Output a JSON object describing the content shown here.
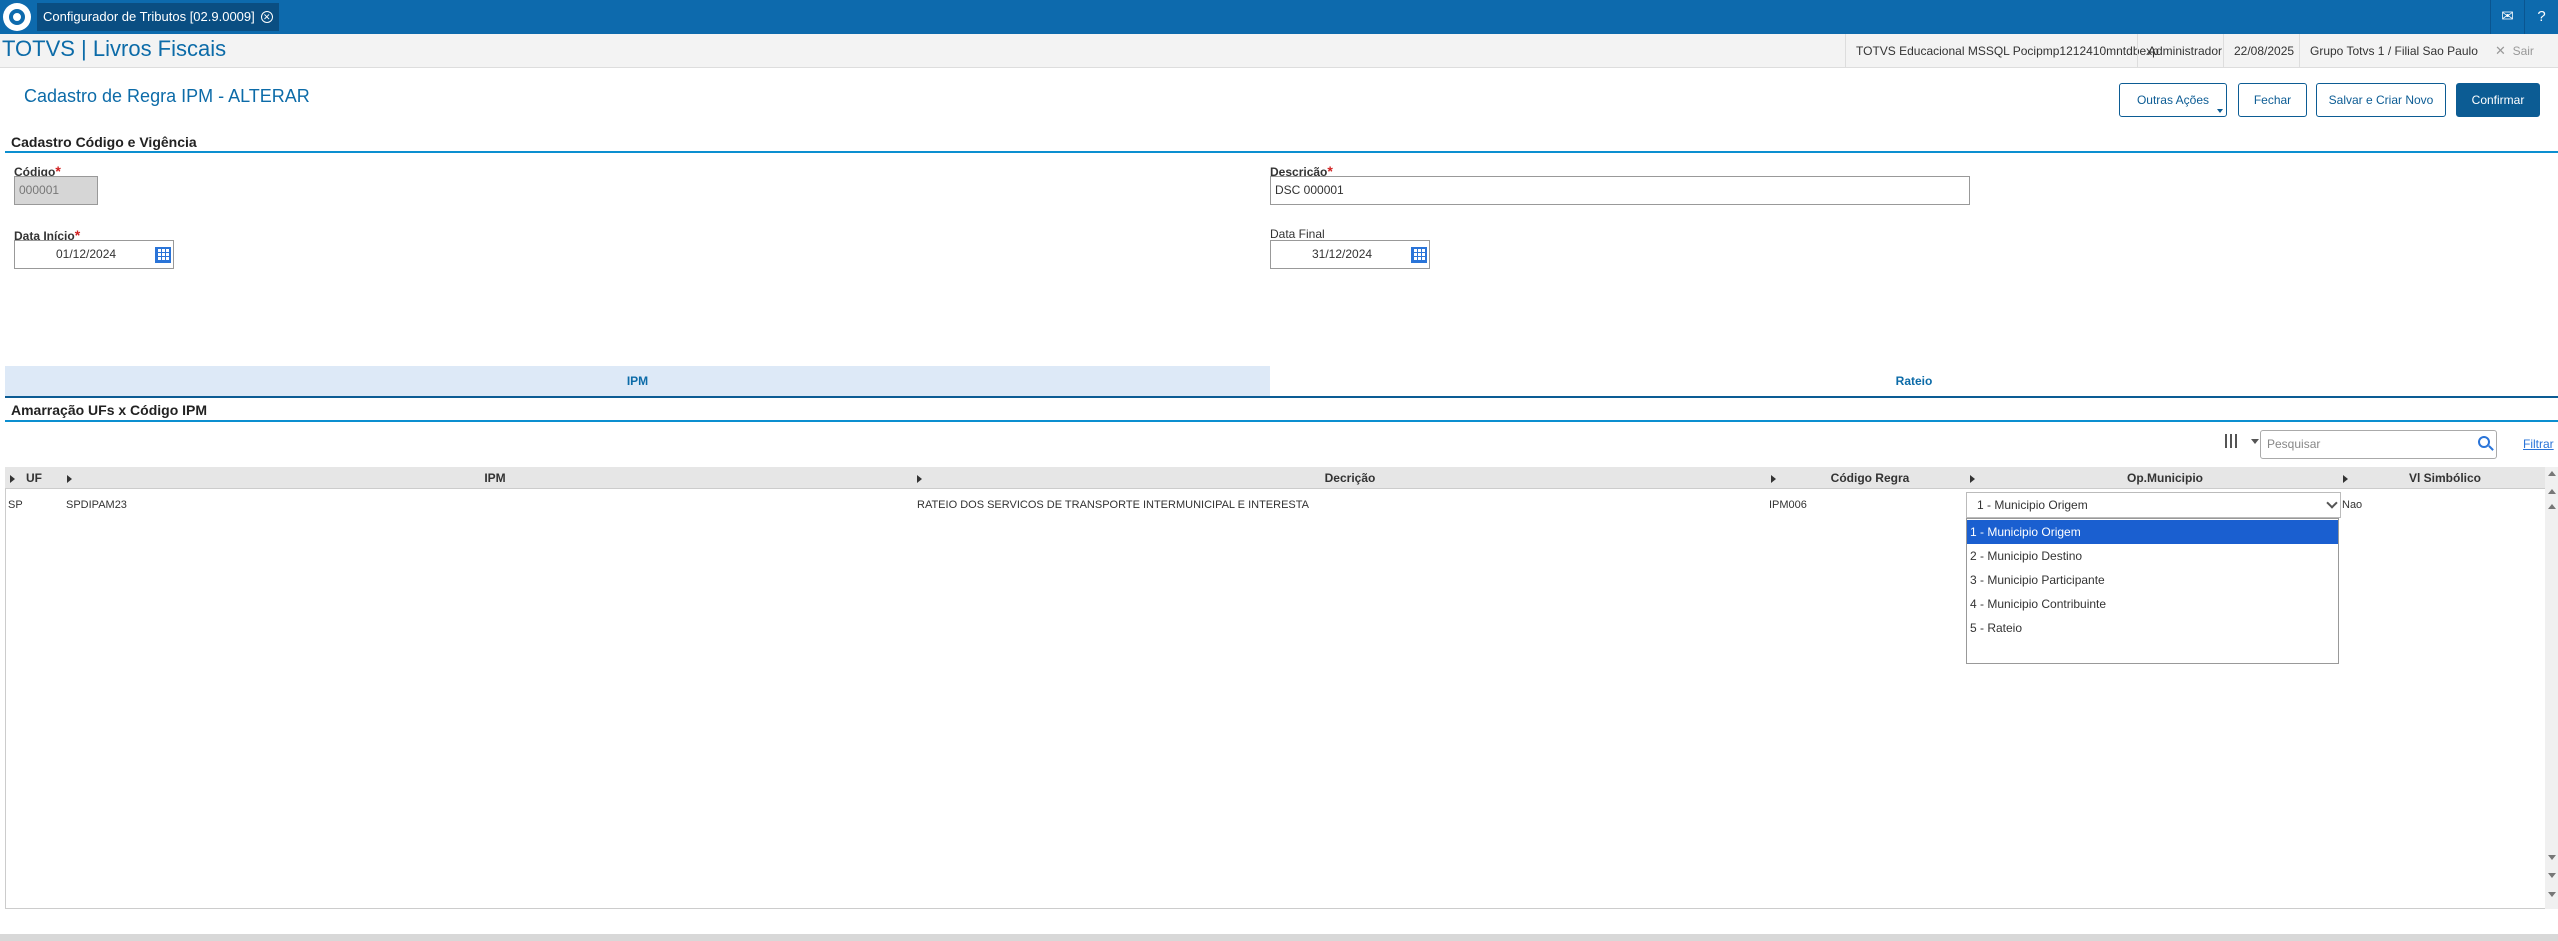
{
  "tabbar": {
    "app_tab": "Configurador de Tributos [02.9.0009]"
  },
  "header": {
    "brand": "TOTVS | Livros Fiscais",
    "environment": "TOTVS Educacional MSSQL Pocipmp1212410mntdbexp",
    "user": "Administrador",
    "date": "22/08/2025",
    "branch": "Grupo Totvs 1 / Filial Sao Paulo",
    "logout": "Sair"
  },
  "page": {
    "title": "Cadastro de Regra IPM - ALTERAR",
    "buttons": {
      "more_actions": "Outras Ações",
      "close": "Fechar",
      "save_new": "Salvar e Criar Novo",
      "confirm": "Confirmar"
    }
  },
  "section1": {
    "title": "Cadastro Código e Vigência",
    "codigo_label": "Código",
    "codigo_value": "000001",
    "descricao_label": "Descrição",
    "descricao_value": "DSC 000001",
    "data_inicio_label": "Data Início",
    "data_inicio_value": "01/12/2024",
    "data_final_label": "Data Final",
    "data_final_value": "31/12/2024",
    "required_mark": "*"
  },
  "tabs": [
    {
      "label": "IPM",
      "active": true
    },
    {
      "label": "Rateio",
      "active": false
    }
  ],
  "section2": {
    "title": "Amarração UFs x Código IPM",
    "search_placeholder": "Pesquisar",
    "filter_label": "Filtrar"
  },
  "grid": {
    "columns": [
      "UF",
      "IPM",
      "Decrição",
      "Código Regra",
      "Op.Municipio",
      "Vl Simbólico"
    ],
    "rows": [
      {
        "uf": "SP",
        "ipm": "SPDIPAM23",
        "descricao": "RATEIO DOS SERVICOS DE TRANSPORTE INTERMUNICIPAL E INTERESTA",
        "codigo_regra": "IPM006",
        "op_municipio": "1 - Municipio Origem",
        "vl_simbolico": "Nao"
      }
    ]
  },
  "dropdown": {
    "options": [
      "1 - Municipio Origem",
      "2 - Municipio Destino",
      "3 - Municipio Participante",
      "4 - Municipio Contribuinte",
      "5 - Rateio"
    ],
    "selected_index": 0
  },
  "colors": {
    "brand_blue": "#0d6aad",
    "accent": "#0c8fd0",
    "selection": "#1a5fd0",
    "required": "#d02020"
  }
}
